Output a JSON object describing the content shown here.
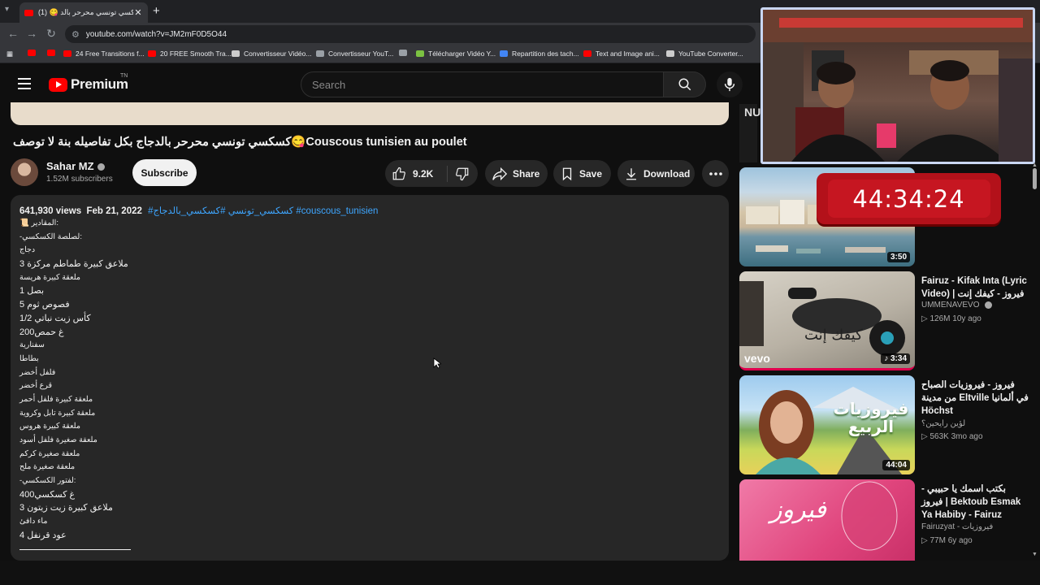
{
  "browser": {
    "tab_title": "(1) 😋 كسكسي تونسي محرحر بالد",
    "url": "youtube.com/watch?v=JM2mF0D5O44",
    "bookmarks": [
      {
        "label": "",
        "color": "#ff0000"
      },
      {
        "label": "",
        "color": "#ff0000"
      },
      {
        "label": "24 Free Transitions f...",
        "color": "#ff0000"
      },
      {
        "label": "20 FREE Smooth Tra...",
        "color": "#ff0000"
      },
      {
        "label": "Convertisseur Vidéo...",
        "color": "#cccccc"
      },
      {
        "label": "Convertisseur YouT...",
        "color": "#9aa0a6"
      },
      {
        "label": "",
        "color": "#9aa0a6"
      },
      {
        "label": "Télécharger Vidéo Y...",
        "color": "#7cc242"
      },
      {
        "label": "Repartition des tach...",
        "color": "#4285f4"
      },
      {
        "label": "Text and Image ani...",
        "color": "#ff0000"
      },
      {
        "label": "YouTube Converter...",
        "color": "#cccccc"
      }
    ]
  },
  "header": {
    "logo_text": "Premium",
    "logo_sup": "TN",
    "search_placeholder": "Search"
  },
  "video": {
    "title": "كسكسي تونسي محرحر بالدجاج بكل تفاصيله بنة لا توصف😋Couscous tunisien au poulet",
    "channel": "Sahar MZ",
    "subscribers": "1.52M subscribers",
    "subscribe_label": "Subscribe",
    "likes": "9.2K",
    "share_label": "Share",
    "save_label": "Save",
    "download_label": "Download"
  },
  "description": {
    "views": "641,930 views",
    "date": "Feb 21, 2022",
    "tags": "#كسكسي_تونسي #كسكسي_بالدجاج #couscous_tunisien",
    "lines": [
      "📜 المقادير:",
      "-لصلصة الكسكسي:",
      "دجاج",
      "3 ملاعق كبيرة طماطم مركزة",
      "ملعقة كبيرة هريسة",
      "1 بصل",
      "5 فصوص ثوم",
      "1/2 كأس زيت نباتي",
      "200غ حمص",
      "سفنارية",
      "بطاطا",
      "فلفل أخضر",
      "قرع أخضر",
      "ملعقة كبيرة فلفل أحمر",
      "ملعقة كبيرة تابل وكروية",
      "ملعقة كبيرة هروس",
      "ملعقة صغيرة فلفل أسود",
      "ملعقة صغيرة كركم",
      "ملعقة صغيرة ملح",
      "-لفتور الكسكسي:",
      "400غ كسكسي",
      "3 ملاعق كبيرة زيت زيتون",
      "ماء دافئ",
      "4 عود قرنفل"
    ]
  },
  "sidebar": {
    "partial_text": "NU",
    "items": [
      {
        "title": "",
        "channel": "",
        "stats": "",
        "duration": "3:50"
      },
      {
        "title": "Fairuz - Kifak Inta (Lyric Video) | فيروز - كيفك إنت",
        "channel": "UMMENAVEVO",
        "stats": "▷ 126M  10y ago",
        "duration": "3:34",
        "brand": "vevo",
        "thumb_text": "كيفك إنت"
      },
      {
        "title": "فيروز - فيروزيات الصباح من مدينة Eltville في ألمانيا Höchst",
        "channel": "لؤين رايحين؟",
        "stats": "▷ 563K  3mo ago",
        "duration": "44:04",
        "thumb_text": "فيروزيات الربيع"
      },
      {
        "title": "بكتب اسمك يا حبيبي - فيروز | Bektoub Esmak Ya Habiby - Fairuz",
        "channel": "Fairuzyat - فيروزيات",
        "stats": "▷ 77M  6y ago",
        "duration": "",
        "thumb_text": "فيروز"
      }
    ]
  },
  "overlay": {
    "timer": "44:34:24"
  }
}
